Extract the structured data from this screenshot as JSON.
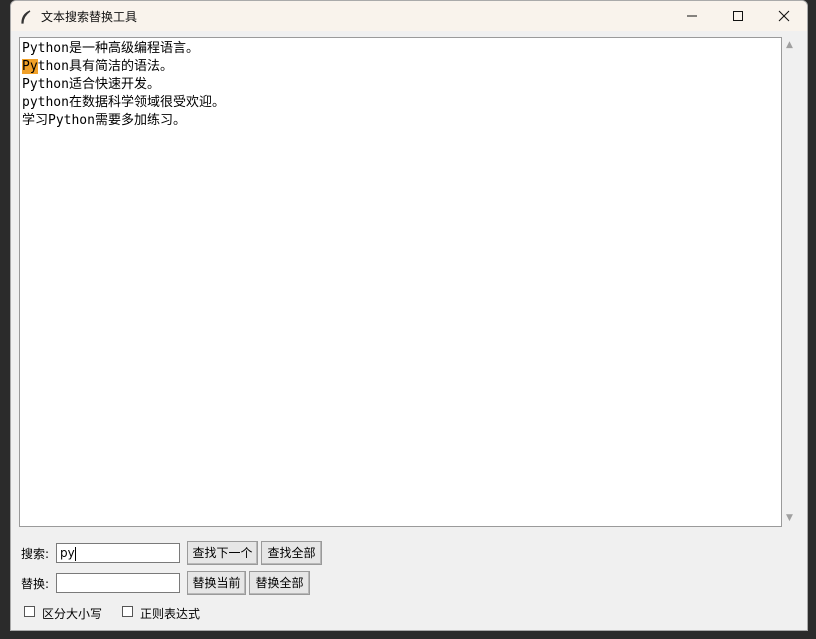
{
  "window": {
    "title": "文本搜索替换工具"
  },
  "title_controls": {
    "minimize": "—",
    "maximize": "☐",
    "close": "✕"
  },
  "editor": {
    "lines": [
      {
        "pre": "",
        "highlight": "",
        "text": "Python是一种高级编程语言。"
      },
      {
        "pre": "",
        "highlight": "Py",
        "text": "thon具有简洁的语法。"
      },
      {
        "pre": "",
        "highlight": "",
        "text": "Python适合快速开发。"
      },
      {
        "pre": "",
        "highlight": "",
        "text": "python在数据科学领域很受欢迎。"
      },
      {
        "pre": "",
        "highlight": "",
        "text": "学习Python需要多加练习。"
      }
    ],
    "highlight_color": "#f0a028"
  },
  "search": {
    "label": "搜索:",
    "value": "py"
  },
  "replace": {
    "label": "替换:",
    "value": ""
  },
  "buttons": {
    "find_next": "查找下一个",
    "find_all": "查找全部",
    "replace_current": "替换当前",
    "replace_all": "替换全部"
  },
  "options": {
    "case_sensitive": {
      "label": "区分大小写",
      "checked": false
    },
    "regex": {
      "label": "正则表达式",
      "checked": false
    }
  }
}
